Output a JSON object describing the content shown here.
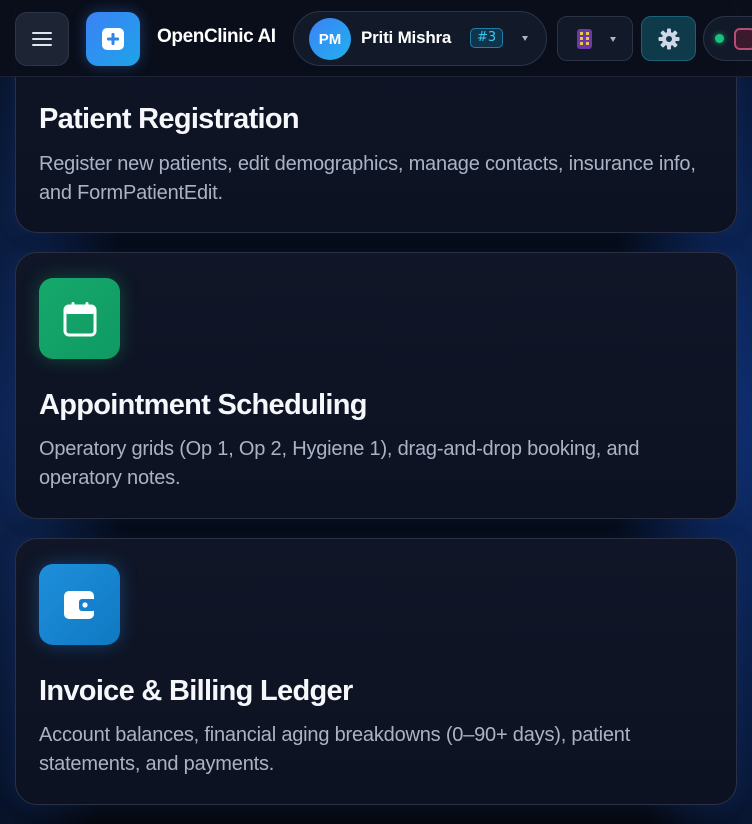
{
  "header": {
    "app_name": "OpenClinic AI",
    "user": {
      "initials": "PM",
      "name": "Priti Mishra",
      "badge": "#3"
    },
    "icons": {
      "menu": "hamburger-menu-icon",
      "logo": "plus-square-icon",
      "apps": "building-icon",
      "settings": "gear-icon",
      "status": "online-status-dot",
      "logout": "logout-icon"
    },
    "colors": {
      "accent_blue": "#3b82f6",
      "badge_cyan": "#3cc7f2",
      "online_green": "#19c37d"
    }
  },
  "modules": [
    {
      "title": "Patient Registration",
      "description": "Register new patients, edit demographics, manage contacts, insurance info, and FormPatientEdit."
    },
    {
      "title": "Appointment Scheduling",
      "description": "Operatory grids (Op 1, Op 2, Hygiene 1), drag-and-drop booking, and operatory notes.",
      "icon": "calendar-icon",
      "icon_color": "#16a86b"
    },
    {
      "title": "Invoice & Billing Ledger",
      "description": "Account balances, financial aging breakdowns (0–90+ days), patient statements, and payments.",
      "icon": "wallet-icon",
      "icon_color": "#1f8fdb"
    }
  ]
}
